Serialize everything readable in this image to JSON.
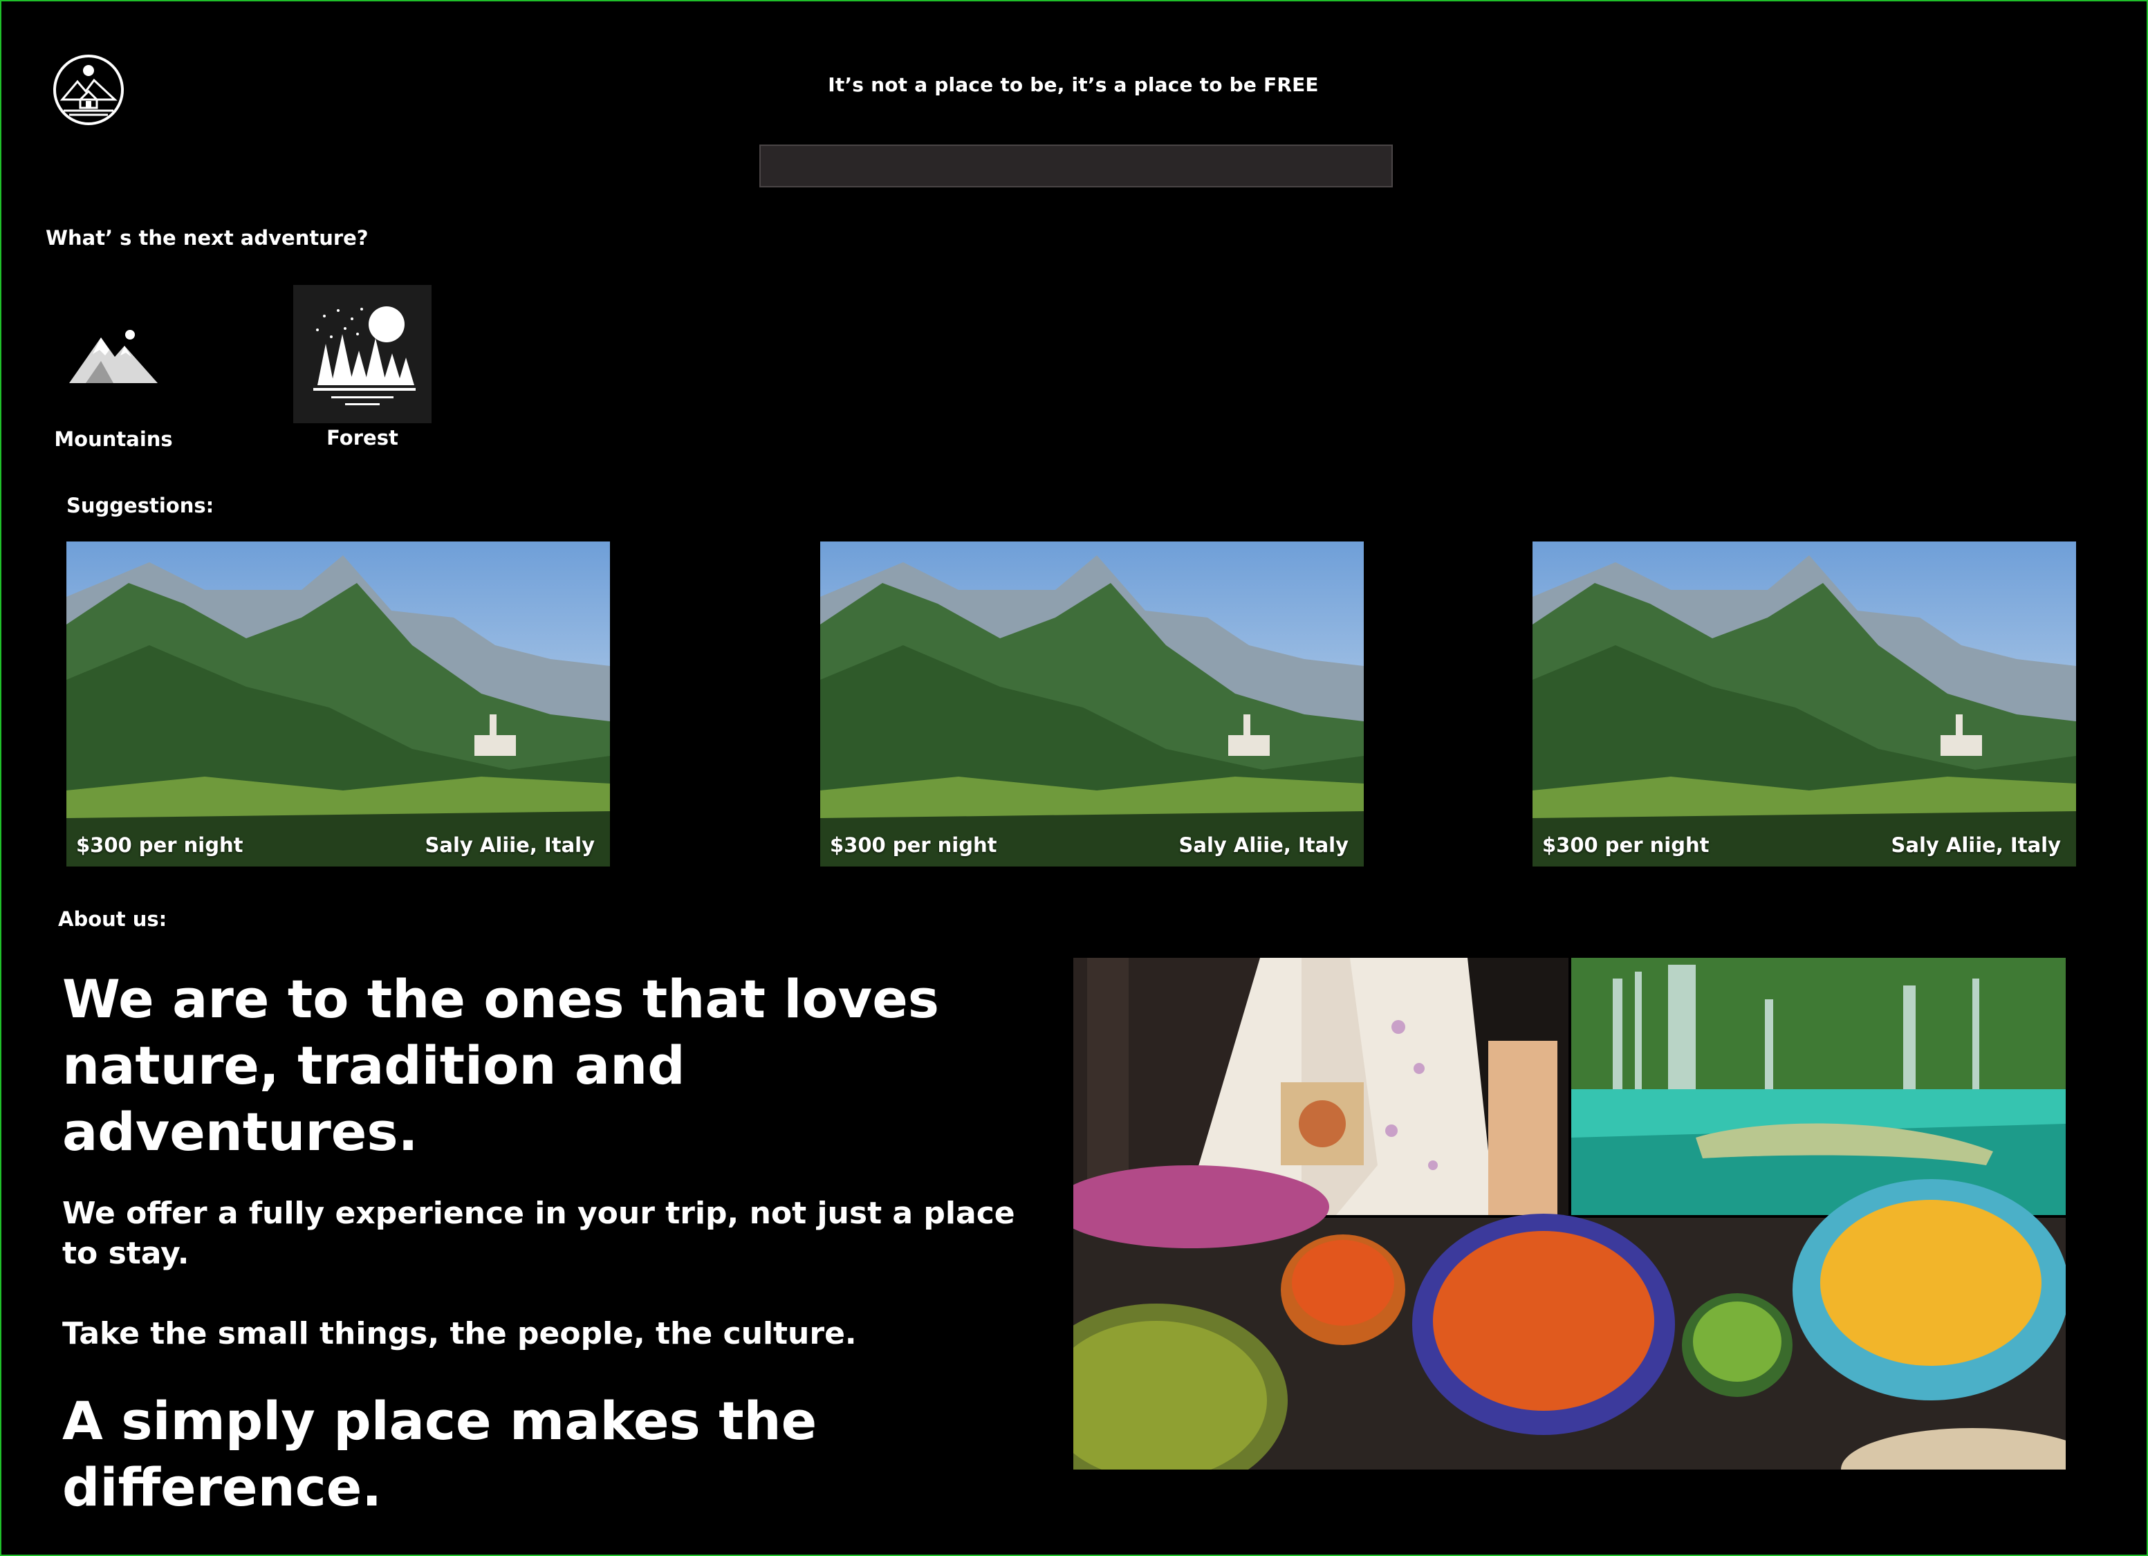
{
  "header": {
    "tagline": "It’s not a place to be, it’s a place to be FREE",
    "logo_icon": "cabin-mountain-logo-icon"
  },
  "search": {
    "value": "",
    "placeholder": ""
  },
  "categories": {
    "heading": "What’ s  the next adventure?",
    "items": [
      {
        "label": "Mountains",
        "icon": "mountains-icon",
        "selected": false
      },
      {
        "label": "Forest",
        "icon": "forest-icon",
        "selected": true
      }
    ]
  },
  "suggestions": {
    "heading": "Suggestions:",
    "cards": [
      {
        "price": "$300 per night",
        "location": "Saly Aliie, Italy",
        "image": "mountain-valley-village-photo"
      },
      {
        "price": "$300 per night",
        "location": "Saly Aliie, Italy",
        "image": "mountain-valley-village-photo"
      },
      {
        "price": "$300 per night",
        "location": "Saly Aliie, Italy",
        "image": "mountain-valley-village-photo"
      }
    ]
  },
  "about": {
    "heading": "About us:",
    "headline": "We are to the ones that loves nature, tradition and adventures.",
    "offer": "We offer a fully experience in your trip, not just a place to stay.",
    "small_things": "Take the small things, the people, the culture.",
    "closing": "A simply place makes the difference.",
    "images": [
      "kimono-photo",
      "waterfall-lake-photo",
      "curry-dishes-photo"
    ]
  },
  "colors": {
    "background": "#000000",
    "text": "#ffffff",
    "search_bg": "#2a2627",
    "frame": "#1fbf2a"
  }
}
